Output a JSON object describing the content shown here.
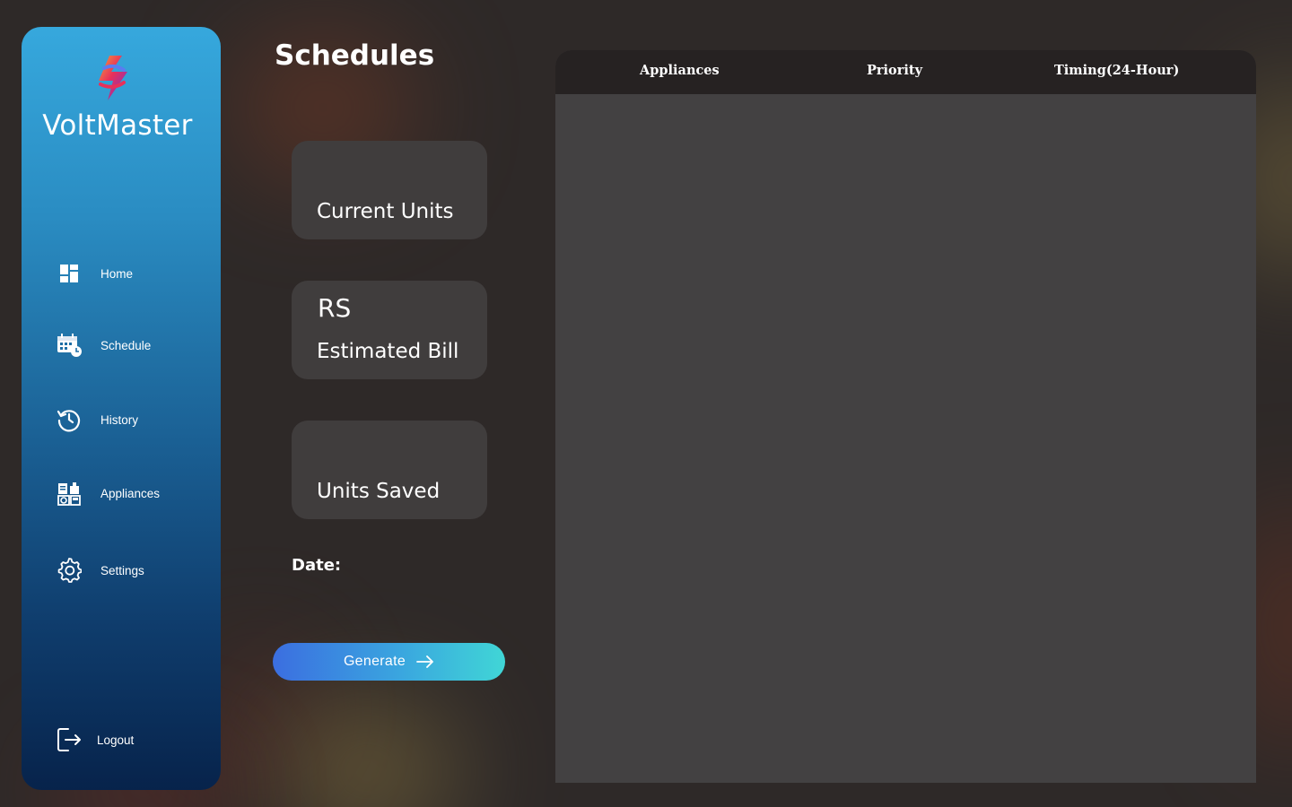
{
  "app": {
    "brand_name": "VoltMaster",
    "logo_icon": "lightning-bolt-logo",
    "accent_gradient": [
      "#36a8dd",
      "#07234b"
    ]
  },
  "sidebar": {
    "items": [
      {
        "label": "Home",
        "icon": "dashboard-icon"
      },
      {
        "label": "Schedule",
        "icon": "calendar-clock-icon"
      },
      {
        "label": "History",
        "icon": "history-icon"
      },
      {
        "label": "Appliances",
        "icon": "appliances-icon"
      },
      {
        "label": "Settings",
        "icon": "gear-icon"
      }
    ],
    "logout": {
      "label": "Logout",
      "icon": "logout-icon"
    }
  },
  "main": {
    "title": "Schedules",
    "cards": {
      "current_units": {
        "label": "Current Units"
      },
      "estimated_bill": {
        "prefix": "RS",
        "label": "Estimated Bill"
      },
      "units_saved": {
        "label": "Units Saved"
      }
    },
    "date_label": "Date:",
    "generate_button": {
      "label": "Generate",
      "icon": "arrow-right-icon"
    }
  },
  "schedule_table": {
    "columns": [
      "Appliances",
      "Priority",
      "Timing(24-Hour)"
    ],
    "rows": []
  },
  "colors": {
    "background": "#2e2928",
    "card": "#403d3d",
    "table_body": "#434142",
    "table_header": "#262222",
    "button_gradient": [
      "#3b6ee0",
      "#40d6d6"
    ]
  }
}
